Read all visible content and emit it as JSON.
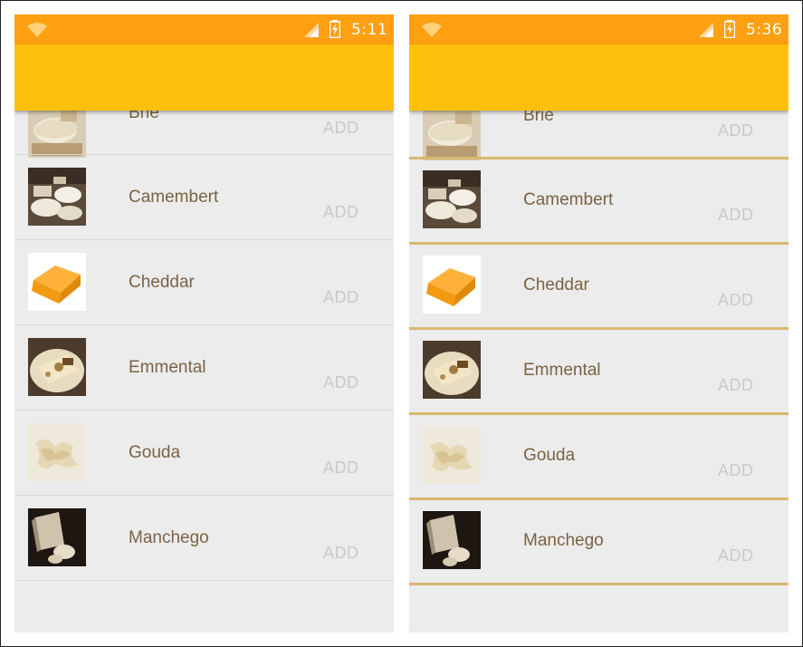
{
  "left": {
    "status": {
      "time": "5:11"
    },
    "items": [
      {
        "name": "Brie",
        "action": "ADD"
      },
      {
        "name": "Camembert",
        "action": "ADD"
      },
      {
        "name": "Cheddar",
        "action": "ADD"
      },
      {
        "name": "Emmental",
        "action": "ADD"
      },
      {
        "name": "Gouda",
        "action": "ADD"
      },
      {
        "name": "Manchego",
        "action": "ADD"
      }
    ]
  },
  "right": {
    "status": {
      "time": "5:36"
    },
    "items": [
      {
        "name": "Brie",
        "action": "ADD"
      },
      {
        "name": "Camembert",
        "action": "ADD"
      },
      {
        "name": "Cheddar",
        "action": "ADD"
      },
      {
        "name": "Emmental",
        "action": "ADD"
      },
      {
        "name": "Gouda",
        "action": "ADD"
      },
      {
        "name": "Manchego",
        "action": "ADD"
      }
    ]
  },
  "colors": {
    "status_bar": "#ff9f12",
    "toolbar": "#ffc00c",
    "list_background": "#ececec",
    "item_text": "#7a6244",
    "add_text": "#c9c9c9",
    "divider_left": "#d6d6d6",
    "divider_right": "#d9b870"
  },
  "icons": {
    "wifi": "wifi-icon",
    "signal": "cell-signal-icon",
    "battery": "battery-charging-icon"
  }
}
